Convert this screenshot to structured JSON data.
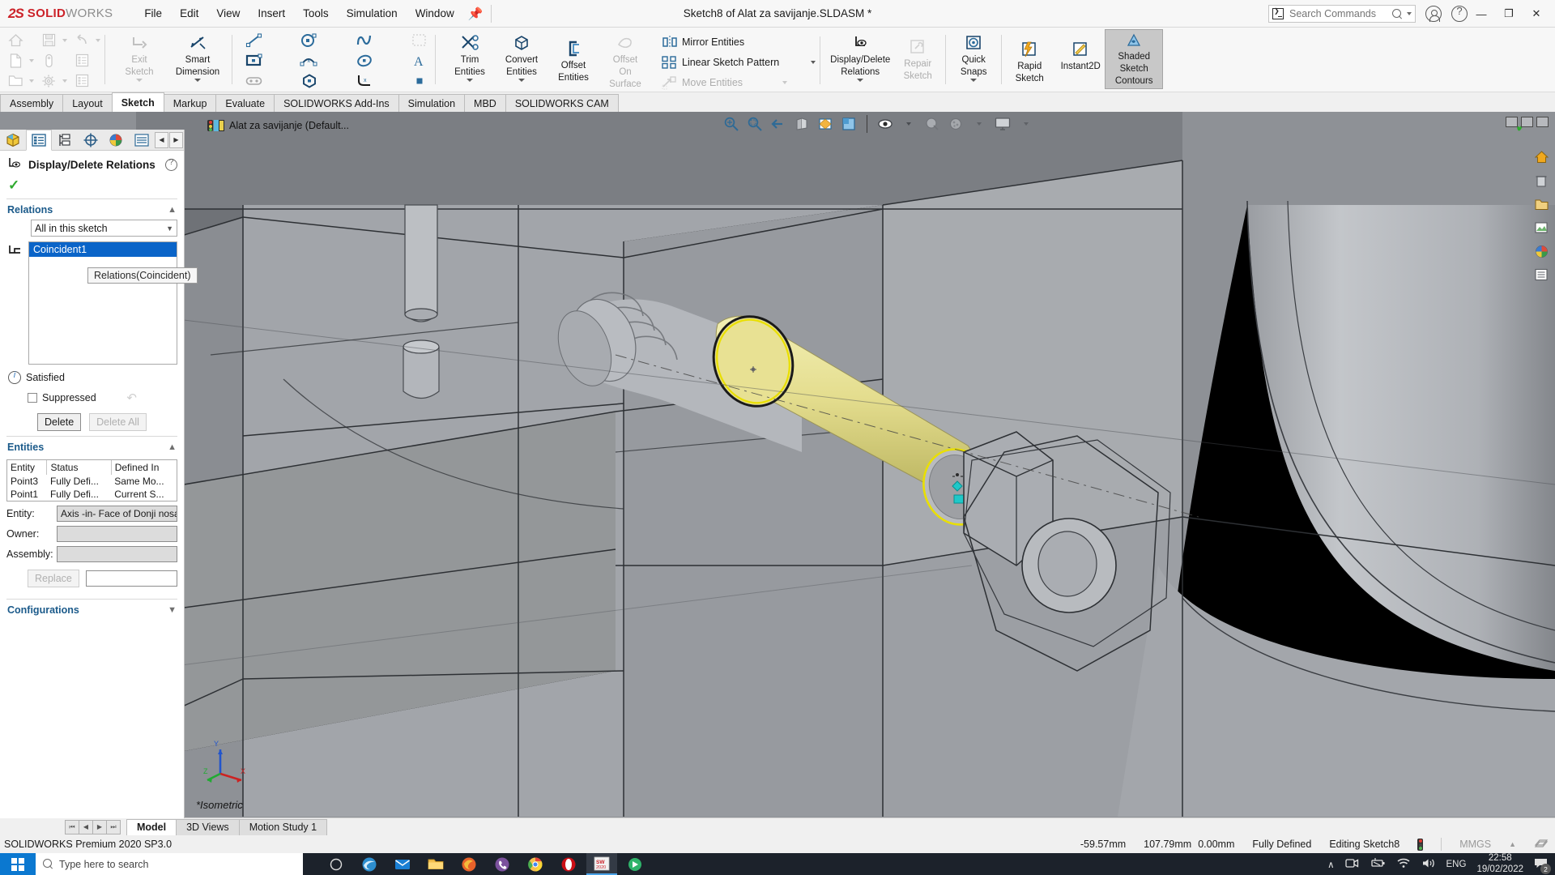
{
  "app": {
    "brand_ds": "2S",
    "brand_solid": "SOLID",
    "brand_works": "WORKS",
    "document_title": "Sketch8 of Alat za savijanje.SLDASM *"
  },
  "menubar": {
    "items": [
      "File",
      "Edit",
      "View",
      "Insert",
      "Tools",
      "Simulation",
      "Window"
    ],
    "pin_icon": "pin-icon"
  },
  "search": {
    "placeholder": "Search Commands",
    "value": ""
  },
  "window_controls": {
    "minimize": "—",
    "restore": "❐",
    "close": "✕"
  },
  "ribbon": {
    "quickaccess": [
      {
        "name": "home-icon",
        "label": "Home",
        "disabled": true
      },
      {
        "name": "save-icon",
        "label": "Save",
        "disabled": true
      },
      {
        "name": "undo-icon",
        "label": "Undo",
        "disabled": true
      },
      {
        "name": "new-doc-icon",
        "label": "New",
        "disabled": true
      },
      {
        "name": "print-icon",
        "label": "Print",
        "disabled": true
      },
      {
        "name": "properties-icon",
        "label": "Properties",
        "disabled": true
      },
      {
        "name": "open-icon",
        "label": "Open",
        "disabled": true
      },
      {
        "name": "options-icon",
        "label": "Options",
        "disabled": true
      },
      {
        "name": "rebuild-icon",
        "label": "Rebuild",
        "disabled": true
      }
    ],
    "buttons": [
      {
        "id": "exit-sketch",
        "l1": "Exit",
        "l2": "Sketch",
        "icon": "exit-sketch-icon",
        "disabled": true,
        "dropdown": true
      },
      {
        "id": "smart-dimension",
        "l1": "Smart",
        "l2": "Dimension",
        "icon": "smart-dimension-icon",
        "disabled": false,
        "dropdown": true
      },
      {
        "id": "trim-entities",
        "l1": "Trim",
        "l2": "Entities",
        "icon": "trim-entities-icon",
        "disabled": false,
        "dropdown": true
      },
      {
        "id": "convert-entities",
        "l1": "Convert",
        "l2": "Entities",
        "icon": "convert-entities-icon",
        "disabled": false,
        "dropdown": true
      },
      {
        "id": "offset-entities",
        "l1": "Offset",
        "l2": "Entities",
        "icon": "offset-entities-icon",
        "disabled": false,
        "dropdown": false
      },
      {
        "id": "offset-on-surface",
        "l1": "Offset",
        "l2": "On",
        "l3": "Surface",
        "icon": "offset-on-surface-icon",
        "disabled": true,
        "dropdown": false
      },
      {
        "id": "display-delete-relations",
        "l1": "Display/Delete",
        "l2": "Relations",
        "icon": "display-delete-relations-icon",
        "disabled": false,
        "dropdown": true
      },
      {
        "id": "repair-sketch",
        "l1": "Repair",
        "l2": "Sketch",
        "icon": "repair-sketch-icon",
        "disabled": true,
        "dropdown": false
      },
      {
        "id": "quick-snaps",
        "l1": "Quick",
        "l2": "Snaps",
        "icon": "quick-snaps-icon",
        "disabled": false,
        "dropdown": true
      },
      {
        "id": "rapid-sketch",
        "l1": "Rapid",
        "l2": "Sketch",
        "icon": "rapid-sketch-icon",
        "disabled": false,
        "dropdown": false
      },
      {
        "id": "instant2d",
        "l1": "Instant2D",
        "l2": "",
        "icon": "instant2d-icon",
        "disabled": false,
        "dropdown": false
      },
      {
        "id": "shaded-sketch-contours",
        "l1": "Shaded",
        "l2": "Sketch",
        "l3": "Contours",
        "icon": "shaded-sketch-contours-icon",
        "disabled": false,
        "selected": true,
        "dropdown": false
      }
    ],
    "small_commands": [
      {
        "id": "mirror-entities",
        "label": "Mirror Entities",
        "icon": "mirror-entities-icon",
        "disabled": false,
        "dropdown": false
      },
      {
        "id": "linear-sketch-pattern",
        "label": "Linear Sketch Pattern",
        "icon": "linear-sketch-pattern-icon",
        "disabled": false,
        "dropdown": true
      },
      {
        "id": "move-entities",
        "label": "Move Entities",
        "icon": "move-entities-icon",
        "disabled": true,
        "dropdown": true
      }
    ]
  },
  "command_tabs": {
    "items": [
      {
        "label": "Assembly",
        "active": false
      },
      {
        "label": "Layout",
        "active": false
      },
      {
        "label": "Sketch",
        "active": true
      },
      {
        "label": "Markup",
        "active": false
      },
      {
        "label": "Evaluate",
        "active": false
      },
      {
        "label": "SOLIDWORKS Add-Ins",
        "active": false
      },
      {
        "label": "Simulation",
        "active": false
      },
      {
        "label": "MBD",
        "active": false
      },
      {
        "label": "SOLIDWORKS CAM",
        "active": false
      }
    ]
  },
  "property_manager": {
    "tabs": [
      {
        "name": "feature-manager-tree-tab",
        "icon": "assembly-tree-icon",
        "active": false
      },
      {
        "name": "property-manager-tab",
        "icon": "property-manager-icon",
        "active": true
      },
      {
        "name": "configuration-manager-tab",
        "icon": "configuration-manager-icon",
        "active": false
      },
      {
        "name": "dimxpert-manager-tab",
        "icon": "dimxpert-icon",
        "active": false
      },
      {
        "name": "display-manager-tab",
        "icon": "display-manager-icon",
        "active": false
      },
      {
        "name": "extra-manager-tab",
        "icon": "extra-panel-icon",
        "active": false
      }
    ],
    "nav_prev": "◀",
    "nav_next": "▶",
    "title": "Display/Delete Relations",
    "help_icon": "help-icon",
    "ok_icon": "ok-check-icon",
    "relations": {
      "section_label": "Relations",
      "filter_value": "All in this sketch",
      "list_items": [
        "Coincident1"
      ],
      "selected_item": "Coincident1",
      "tooltip": "Relations(Coincident)",
      "status_label": "Satisfied",
      "suppressed_label": "Suppressed",
      "suppressed_checked": false,
      "delete_label": "Delete",
      "delete_all_label": "Delete All",
      "delete_all_disabled": true
    },
    "entities": {
      "section_label": "Entities",
      "columns": [
        "Entity",
        "Status",
        "Defined In"
      ],
      "rows": [
        [
          "Point3",
          "Fully Defi...",
          "Same Mo..."
        ],
        [
          "Point1",
          "Fully Defi...",
          "Current S..."
        ]
      ],
      "entity_label": "Entity:",
      "entity_value": "Axis -in- Face of Donji nosa",
      "owner_label": "Owner:",
      "owner_value": "",
      "assembly_label": "Assembly:",
      "assembly_value": "",
      "replace_label": "Replace",
      "replace_value": "",
      "replace_disabled": true
    },
    "configurations": {
      "section_label": "Configurations"
    }
  },
  "viewport": {
    "tree_item_label": "Alat za savijanje  (Default...",
    "tree_item_icon": "assembly-doc-icon",
    "orientation_label": "*Isometric",
    "view_toolbar": [
      {
        "name": "zoom-to-fit-icon"
      },
      {
        "name": "zoom-to-area-icon"
      },
      {
        "name": "previous-view-icon"
      },
      {
        "name": "section-view-icon"
      },
      {
        "name": "view-orientation-icon"
      },
      {
        "name": "display-style-icon"
      },
      {
        "name": "hide-show-icon"
      },
      {
        "name": "edit-appearance-icon"
      },
      {
        "name": "apply-scene-icon"
      },
      {
        "name": "view-settings-icon"
      }
    ],
    "right_icons": [
      {
        "name": "view-home-icon"
      },
      {
        "name": "view-delete-icon"
      },
      {
        "name": "view-folder-icon"
      },
      {
        "name": "view-image-icon"
      },
      {
        "name": "view-appearance-icon"
      },
      {
        "name": "view-list-icon"
      }
    ],
    "confirm_icon": "confirm-check-icon",
    "triad_axes": [
      "X",
      "Y",
      "Z"
    ]
  },
  "bottom_tabs": {
    "items": [
      {
        "label": "Model",
        "active": true
      },
      {
        "label": "3D Views",
        "active": false
      },
      {
        "label": "Motion Study 1",
        "active": false
      }
    ]
  },
  "statusbar": {
    "version": "SOLIDWORKS Premium 2020 SP3.0",
    "coord_x": "-59.57mm",
    "coord_y": "107.79mm",
    "coord_z": "0.00mm",
    "state": "Fully Defined",
    "editing": "Editing Sketch8",
    "units": "MMGS",
    "units_caret": "▲",
    "overlay_icon": "overlay-icon"
  },
  "taskbar": {
    "start_icon": "windows-start-icon",
    "search_placeholder": "Type here to search",
    "apps": [
      {
        "name": "task-view-icon",
        "color": "#ffffff"
      },
      {
        "name": "edge-icon",
        "color": "#2d8ecf"
      },
      {
        "name": "mail-icon",
        "color": "#1a7fd4"
      },
      {
        "name": "file-explorer-icon",
        "color": "#f4bf4f"
      },
      {
        "name": "firefox-icon",
        "color": "#e8622a"
      },
      {
        "name": "viber-icon",
        "color": "#7b519d"
      },
      {
        "name": "chrome-icon",
        "color": "#4285f4"
      },
      {
        "name": "opera-icon",
        "color": "#cc0f16"
      },
      {
        "name": "solidworks-icon",
        "color": "#cc2229",
        "active": true
      },
      {
        "name": "app-icon",
        "color": "#3bbf6a"
      }
    ],
    "tray": {
      "chevron": "∧",
      "icons": [
        "device-icon",
        "battery-icon",
        "wifi-icon",
        "volume-icon"
      ],
      "language": "ENG",
      "time": "22:58",
      "date": "19/02/2022",
      "notifications_count": "2"
    }
  },
  "colors": {
    "brand_red": "#cc2229",
    "accent_blue": "#0a64c8",
    "section_blue": "#1b5a8a",
    "highlight_yellow": "#e6e08a",
    "viewport_gray": "#8e9196",
    "taskbar_dark": "#1c222b"
  }
}
